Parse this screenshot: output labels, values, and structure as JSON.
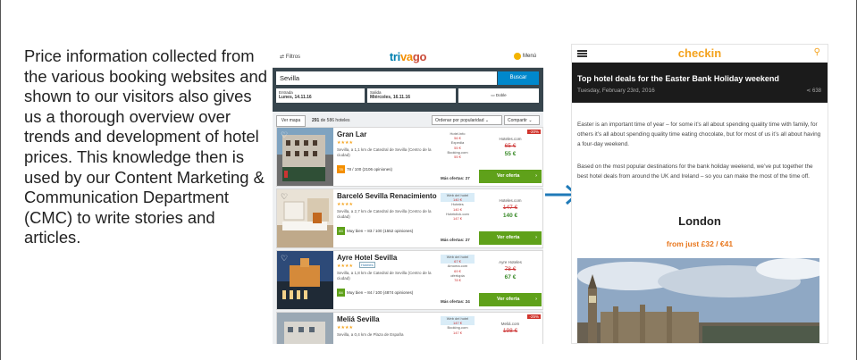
{
  "slide": {
    "paragraph": "Price information collected from the various booking websites and shown to our visitors also gives us a thorough overview over trends and development of hotel prices. This knowledge then is used by our Content Marketing & Communication Department (CMC) to write stories and articles."
  },
  "trivago": {
    "filter_label": "Filtros",
    "logo": {
      "part1": "tri",
      "part2": "va",
      "part3": "go"
    },
    "menu_label": "Menú",
    "search_value": "Sevilla",
    "search_button": "Buscar",
    "checkin_label": "Entrada",
    "checkin_value": "Lunes, 14.11.16",
    "checkout_label": "Salida",
    "checkout_value": "Miércoles, 16.11.16",
    "rooms_label": "Doble",
    "map_button": "Ver mapa",
    "count_number": "291",
    "count_text": "de 586 hoteles",
    "sort_select": "Ordenar por popularidad",
    "compare_select": "Compartir",
    "offer_label": "Ver oferta",
    "hotels": [
      {
        "name": "Gran Lar",
        "stars": "★★★★",
        "location": "Sevilla, a 1,1 km de Catedral de Sevilla (Centro de la ciudad)",
        "rating_score": "78",
        "rating_text": "78 / 100 (2106 opiniones)",
        "prices": [
          "Hotel.info",
          "56 €",
          "Expedia",
          "55 €",
          "Booking.com",
          "55 €"
        ],
        "more_offers": "Más ofertas: 27",
        "main_provider": "Hoteles.com",
        "old_price": "65 €",
        "new_price": "55 €",
        "discount": "-20%"
      },
      {
        "name": "Barceló Sevilla Renacimiento",
        "stars": "★★★★",
        "location": "Sevilla, a 2,7 km de Catedral de Sevilla (Centro de la ciudad)",
        "rating_score": "83",
        "rating_text": "Muy bien – 83 / 100 (1552 opiniones)",
        "prices": [
          "Web del hotel",
          "140 €",
          "Hoteles",
          "140 €",
          "Hotelclick.com",
          "147 €"
        ],
        "more_offers": "Más ofertas: 27",
        "main_provider": "Hoteles.com",
        "old_price": "147 €",
        "new_price": "140 €",
        "discount": ""
      },
      {
        "name": "Ayre Hotel Sevilla",
        "stars": "★★★★",
        "badge": "Hoteles",
        "location": "Sevilla, a 1,8 km de Catedral de Sevilla (Centro de la ciudad)",
        "rating_score": "84",
        "rating_text": "Muy bien – 84 / 100 (4874 opiniones)",
        "prices": [
          "Web del hotel",
          "67 €",
          "Amoma.com",
          "69 €",
          "ofertopia",
          "78 €"
        ],
        "more_offers": "Más ofertas: 24",
        "main_provider": "Ayre Hoteles",
        "old_price": "78 €",
        "new_price": "67 €",
        "discount": ""
      },
      {
        "name": "Meliá Sevilla",
        "stars": "★★★★",
        "location": "Sevilla, a 0,4 km de Plaza de España",
        "rating_score": "",
        "rating_text": "",
        "prices": [
          "Web del hotel",
          "147 €",
          "Booking.com",
          "147 €"
        ],
        "more_offers": "",
        "main_provider": "Meliá.com",
        "old_price": "198 €",
        "new_price": "",
        "discount": "-25%"
      }
    ]
  },
  "checkin": {
    "logo": "checkin",
    "title": "Top hotel deals for the Easter Bank Holiday weekend",
    "date": "Tuesday, February 23rd, 2016",
    "shares": "638",
    "para1": "Easter is an important time of year – for some it’s all about spending quality time with family, for others it’s all about spending quality time eating chocolate, but for most of us it’s all about having a four-day weekend.",
    "para2": "Based on the most popular destinations for the bank holiday weekend, we’ve put together the best hotel deals from around the UK and Ireland – so you can make the most of the time off.",
    "city": "London",
    "from_price": "from just £32 / €41"
  },
  "colors": {
    "trivago_blue": "#007faf",
    "trivago_orange": "#f48f00",
    "trivago_red": "#c94a38",
    "offer_green": "#5fa11a",
    "checkin_orange": "#f4a21c",
    "arrow_blue": "#1f7ab8"
  }
}
